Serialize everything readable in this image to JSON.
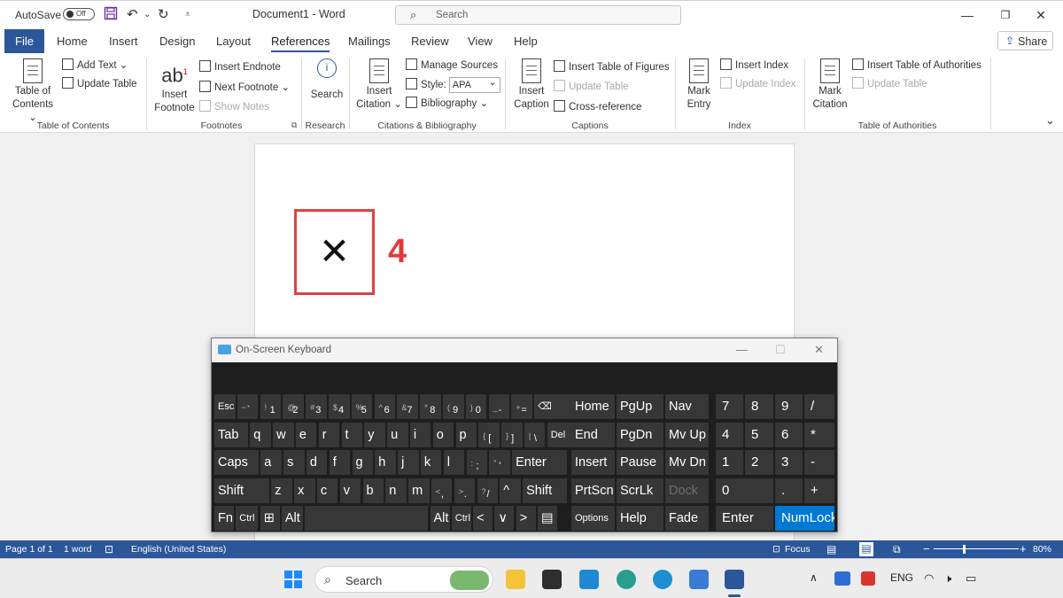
{
  "titlebar": {
    "autosave_label": "AutoSave",
    "autosave_state": "Off",
    "document_title": "Document1  -  Word",
    "search_placeholder": "Search"
  },
  "tabs": [
    "File",
    "Home",
    "Insert",
    "Design",
    "Layout",
    "References",
    "Mailings",
    "Review",
    "View",
    "Help"
  ],
  "active_tab": "References",
  "share_label": "Share",
  "ribbon": {
    "toc": {
      "add_text": "Add Text",
      "update_table": "Update Table",
      "table_of_contents_1": "Table of",
      "table_of_contents_2": "Contents",
      "group": "Table of Contents"
    },
    "footnotes": {
      "insert_1": "Insert",
      "insert_2": "Footnote",
      "insert_endnote": "Insert Endnote",
      "next_footnote": "Next Footnote",
      "show_notes": "Show Notes",
      "group": "Footnotes",
      "ab": "ab"
    },
    "research": {
      "search": "Search",
      "group": "Research"
    },
    "citations": {
      "insert_1": "Insert",
      "insert_2": "Citation",
      "manage_sources": "Manage Sources",
      "style_label": "Style:",
      "style_value": "APA",
      "bibliography": "Bibliography",
      "group": "Citations & Bibliography"
    },
    "captions": {
      "insert_1": "Insert",
      "insert_2": "Caption",
      "insert_table_of_figures": "Insert Table of Figures",
      "update_table": "Update Table",
      "cross_reference": "Cross-reference",
      "group": "Captions"
    },
    "index": {
      "mark_1": "Mark",
      "mark_2": "Entry",
      "insert_index": "Insert Index",
      "update_index": "Update Index",
      "group": "Index"
    },
    "authorities": {
      "mark_1": "Mark",
      "mark_2": "Citation",
      "insert_table": "Insert Table of Authorities",
      "update_table": "Update Table",
      "group": "Table of Authorities"
    }
  },
  "document": {
    "callout_number": "4"
  },
  "osk": {
    "title": "On-Screen Keyboard",
    "row1": [
      {
        "label": "Esc"
      },
      {
        "shift": "~",
        "base": "`"
      },
      {
        "shift": "!",
        "base": "1"
      },
      {
        "shift": "@",
        "base": "2"
      },
      {
        "shift": "#",
        "base": "3"
      },
      {
        "shift": "$",
        "base": "4"
      },
      {
        "shift": "%",
        "base": "5"
      },
      {
        "shift": "^",
        "base": "6"
      },
      {
        "shift": "&",
        "base": "7"
      },
      {
        "shift": "*",
        "base": "8"
      },
      {
        "shift": "(",
        "base": "9"
      },
      {
        "shift": ")",
        "base": "0"
      },
      {
        "shift": "_",
        "base": "-"
      },
      {
        "shift": "+",
        "base": "="
      },
      {
        "label": "⌫"
      }
    ],
    "row2": [
      "Tab",
      "q",
      "w",
      "e",
      "r",
      "t",
      "y",
      "u",
      "i",
      "o",
      "p",
      "[",
      "]",
      "\\",
      "Del"
    ],
    "row2_shift": {
      "11": "{",
      "12": "}",
      "13": "|"
    },
    "row3": [
      "Caps",
      "a",
      "s",
      "d",
      "f",
      "g",
      "h",
      "j",
      "k",
      "l",
      ";",
      "'",
      "Enter"
    ],
    "row3_shift": {
      "10": ":",
      "11": "\""
    },
    "row4": [
      "Shift",
      "z",
      "x",
      "c",
      "v",
      "b",
      "n",
      "m",
      ",",
      ".",
      "/",
      "^",
      "Shift"
    ],
    "row4_shift": {
      "8": "<",
      "9": ">",
      "10": "?"
    },
    "row5": [
      "Fn",
      "Ctrl",
      "⊞",
      "Alt",
      "",
      "Alt",
      "Ctrl",
      "<",
      "∨",
      ">",
      "▤"
    ],
    "nav": [
      [
        "Home",
        "PgUp",
        "Nav"
      ],
      [
        "End",
        "PgDn",
        "Mv Up"
      ],
      [
        "Insert",
        "Pause",
        "Mv Dn"
      ],
      [
        "PrtScn",
        "ScrLk",
        "Dock"
      ],
      [
        "Options",
        "Help",
        "Fade"
      ]
    ],
    "numpad": [
      [
        "7",
        "8",
        "9",
        "/"
      ],
      [
        "4",
        "5",
        "6",
        "*"
      ],
      [
        "1",
        "2",
        "3",
        "-"
      ],
      [
        "0",
        "",
        ".",
        "+"
      ],
      [
        "Enter",
        "",
        "NumLock",
        ""
      ]
    ]
  },
  "statusbar": {
    "page": "Page 1 of 1",
    "words": "1 word",
    "language": "English (United States)",
    "focus": "Focus",
    "zoom": "80%",
    "minus": "−",
    "plus": "+"
  },
  "taskbar": {
    "search": "Search",
    "language": "ENG"
  },
  "colors": {
    "word_blue": "#2b579a",
    "callout_red": "#e03a3a",
    "osk_key": "#373737",
    "numlock_blue": "#0078d4"
  }
}
